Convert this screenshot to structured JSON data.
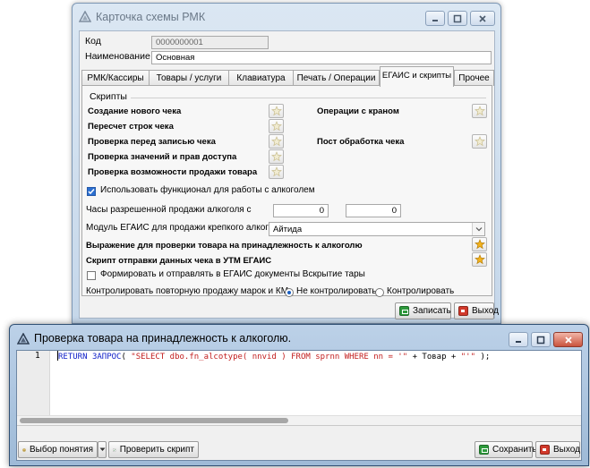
{
  "card_window": {
    "title": "Карточка схемы РМК",
    "fields": {
      "code_label": "Код",
      "code_value": "0000000001",
      "name_label": "Наименование",
      "name_value": "Основная"
    },
    "tabs": [
      {
        "label": "РМК/Кассиры",
        "active": false
      },
      {
        "label": "Товары / услуги",
        "active": false
      },
      {
        "label": "Клавиатура",
        "active": false
      },
      {
        "label": "Печать / Операции",
        "active": false
      },
      {
        "label": "ЕГАИС и скрипты",
        "active": true
      },
      {
        "label": "Прочее",
        "active": false
      }
    ],
    "scripts_group": {
      "title": "Скрипты",
      "left_items": [
        "Создание нового чека",
        "Пересчет строк чека",
        "Проверка перед записью чека",
        "Проверка значений и прав доступа",
        "Проверка возможности продажи товара"
      ],
      "right_items": [
        "Операции с краном",
        "Пост обработка чека"
      ]
    },
    "alcohol": {
      "use_alcohol_label": "Использовать функционал для работы с алкоголем",
      "use_alcohol_checked": true,
      "hours_label": "Часы разрешенной продажи алкоголя с",
      "hours_from": "0",
      "hours_to": "0",
      "module_label": "Модуль ЕГАИС для продажи крепкого алкоголя",
      "module_value": "Айтида",
      "expr_label": "Выражение для проверки товара на принадлежность к алкоголю",
      "utm_script_label": "Скрипт отправки данных чека в УТМ ЕГАИС",
      "send_docs_label": "Формировать и отправлять в ЕГАИС документы Вскрытие тары",
      "send_docs_checked": false,
      "control_label": "Контролировать повторную продажу марок и КМ",
      "control_options": [
        "Не контролировать",
        "Контролировать"
      ],
      "control_selected": 0
    },
    "buttons": {
      "save": "Записать",
      "exit": "Выход"
    },
    "colors": {
      "titlebar_inactive": "#c5d7ea",
      "accent": "#2b6fd1"
    }
  },
  "script_window": {
    "title": "Проверка товара на принадлежность к алкоголю.",
    "line_number": "1",
    "code": {
      "kw1": "RETURN",
      "kw2": "ЗАПРОС",
      "p1": "( ",
      "str1": "\"SELECT dbo.fn_alcotype( nnvid ) FROM sprnn WHERE nn = '\"",
      "mid": " + Товар + ",
      "str2": "\"'\"",
      "end": " );"
    },
    "buttons": {
      "choose": "Выбор понятия",
      "check": "Проверить скрипт",
      "save": "Сохранить",
      "exit": "Выход"
    },
    "colors": {
      "keyword": "#1020c8",
      "string": "#c21d1d"
    }
  }
}
